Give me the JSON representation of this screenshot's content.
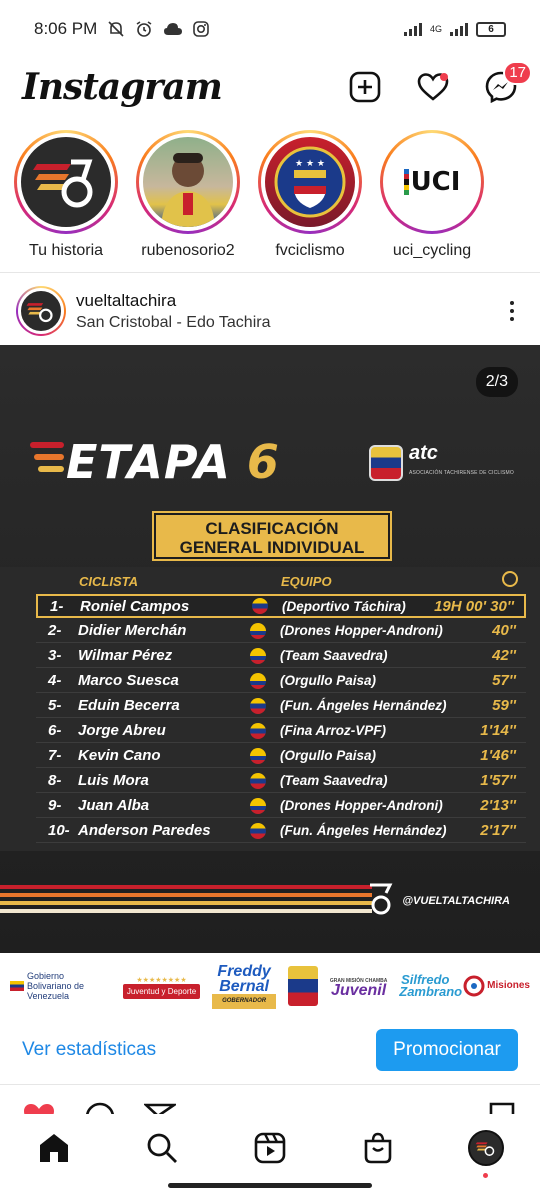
{
  "status_bar": {
    "time": "8:06 PM",
    "network_label": "4G",
    "battery_level": "6"
  },
  "header": {
    "logo": "Instagram",
    "messages_badge": "17"
  },
  "stories": [
    {
      "label": "Tu historia"
    },
    {
      "label": "rubenosorio2"
    },
    {
      "label": "fvciclismo"
    },
    {
      "label": "uci_cycling"
    }
  ],
  "stories_extra": {
    "uci_logo_text": "UCI"
  },
  "post": {
    "username": "vueltaltachira",
    "location": "San Cristobal - Edo Tachira",
    "pager": "2/3",
    "graphic": {
      "stage_word": "ETAPA",
      "stage_number": "6",
      "org_logo_text": "atc",
      "org_logo_sub": "ASOCIACIÓN TACHIRENSE DE CICLISMO",
      "title_line1": "CLASIFICACIÓN",
      "title_line2": "GENERAL INDIVIDUAL",
      "col_name": "CICLISTA",
      "col_team": "EQUIPO",
      "handle": "@VUELTALTACHIRA",
      "rows": [
        {
          "pos": "1-",
          "name": "Roniel Campos",
          "team": "(Deportivo Táchira)",
          "time": "19H 00' 30''",
          "flag": "ven"
        },
        {
          "pos": "2-",
          "name": "Didier Merchán",
          "team": "(Drones Hopper-Androni)",
          "time": "40''",
          "flag": "col"
        },
        {
          "pos": "3-",
          "name": "Wilmar Pérez",
          "team": "(Team Saavedra)",
          "time": "42''",
          "flag": "col"
        },
        {
          "pos": "4-",
          "name": "Marco Suesca",
          "team": "(Orgullo Paisa)",
          "time": "57''",
          "flag": "col"
        },
        {
          "pos": "5-",
          "name": "Eduin Becerra",
          "team": "(Fun. Ángeles Hernández)",
          "time": "59''",
          "flag": "ven"
        },
        {
          "pos": "6-",
          "name": "Jorge Abreu",
          "team": "(Fina Arroz-VPF)",
          "time": "1'14''",
          "flag": "ven"
        },
        {
          "pos": "7-",
          "name": "Kevin Cano",
          "team": "(Orgullo Paisa)",
          "time": "1'46''",
          "flag": "col"
        },
        {
          "pos": "8-",
          "name": "Luis Mora",
          "team": "(Team Saavedra)",
          "time": "1'57''",
          "flag": "ven"
        },
        {
          "pos": "9-",
          "name": "Juan Alba",
          "team": "(Drones Hopper-Androni)",
          "time": "2'13''",
          "flag": "col"
        },
        {
          "pos": "10-",
          "name": "Anderson Paredes",
          "team": "(Fun. Ángeles Hernández)",
          "time": "2'17''",
          "flag": "ven"
        }
      ]
    },
    "sponsors": {
      "gob": "Gobierno Bolivariano de Venezuela",
      "juventud": "Juventud y Deporte",
      "freddy": "Freddy Bernal",
      "freddy_sub": "GOBERNADOR",
      "juvenil_top": "GRAN MISIÓN CHAMBA",
      "juvenil": "Juvenil",
      "silfredo": "Silfredo Zambrano",
      "misiones": "Misiones"
    }
  },
  "actions": {
    "stats_link": "Ver estadísticas",
    "promote": "Promocionar"
  },
  "colors": {
    "accent_gold": "#e8b94a",
    "ig_blue": "#1d9bf0",
    "badge_red": "#ef3d4d"
  },
  "icons": [
    "mute-icon",
    "alarm-icon",
    "cloud-icon",
    "instagram-small-icon",
    "signal-icon",
    "battery-icon",
    "new-post-icon",
    "heart-icon",
    "messenger-icon",
    "more-icon",
    "stopwatch-icon",
    "home-icon",
    "search-icon",
    "reels-icon",
    "shop-icon",
    "profile-icon"
  ]
}
